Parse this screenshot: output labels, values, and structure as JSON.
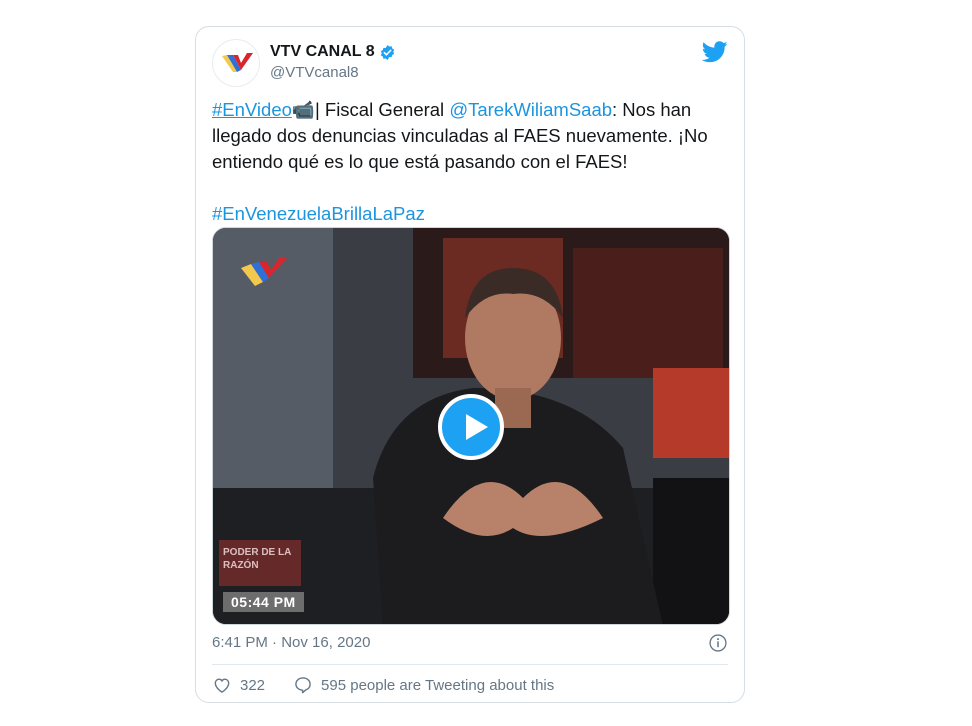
{
  "user": {
    "display_name": "VTV CANAL 8",
    "handle": "@VTVcanal8"
  },
  "tweet": {
    "hashtag_video": "#EnVideo",
    "camera_emoji": "📹",
    "text_a": "| Fiscal General ",
    "mention": "@TarekWiliamSaab",
    "text_b": ": Nos han llegado dos denuncias vinculadas al FAES nuevamente. ¡No entiendo qué es lo que está pasando con el FAES!",
    "hashtag_end": "#EnVenezuelaBrillaLaPaz"
  },
  "media": {
    "overlay_time": "05:44 PM",
    "show_name": "PODER DE LA RAZÓN"
  },
  "meta": {
    "time": "6:41 PM",
    "separator": " · ",
    "date": "Nov 16, 2020"
  },
  "actions": {
    "likes": "322",
    "conversation": "595 people are Tweeting about this"
  },
  "colors": {
    "link": "#1b95e0",
    "twitter_blue": "#1da1f2",
    "text": "#14171a",
    "muted": "#657786"
  },
  "icons": {
    "verified": "verified-badge-icon",
    "twitter": "twitter-bird-icon",
    "info": "info-icon",
    "like": "heart-icon",
    "reply": "speech-bubble-icon",
    "play": "play-icon"
  }
}
